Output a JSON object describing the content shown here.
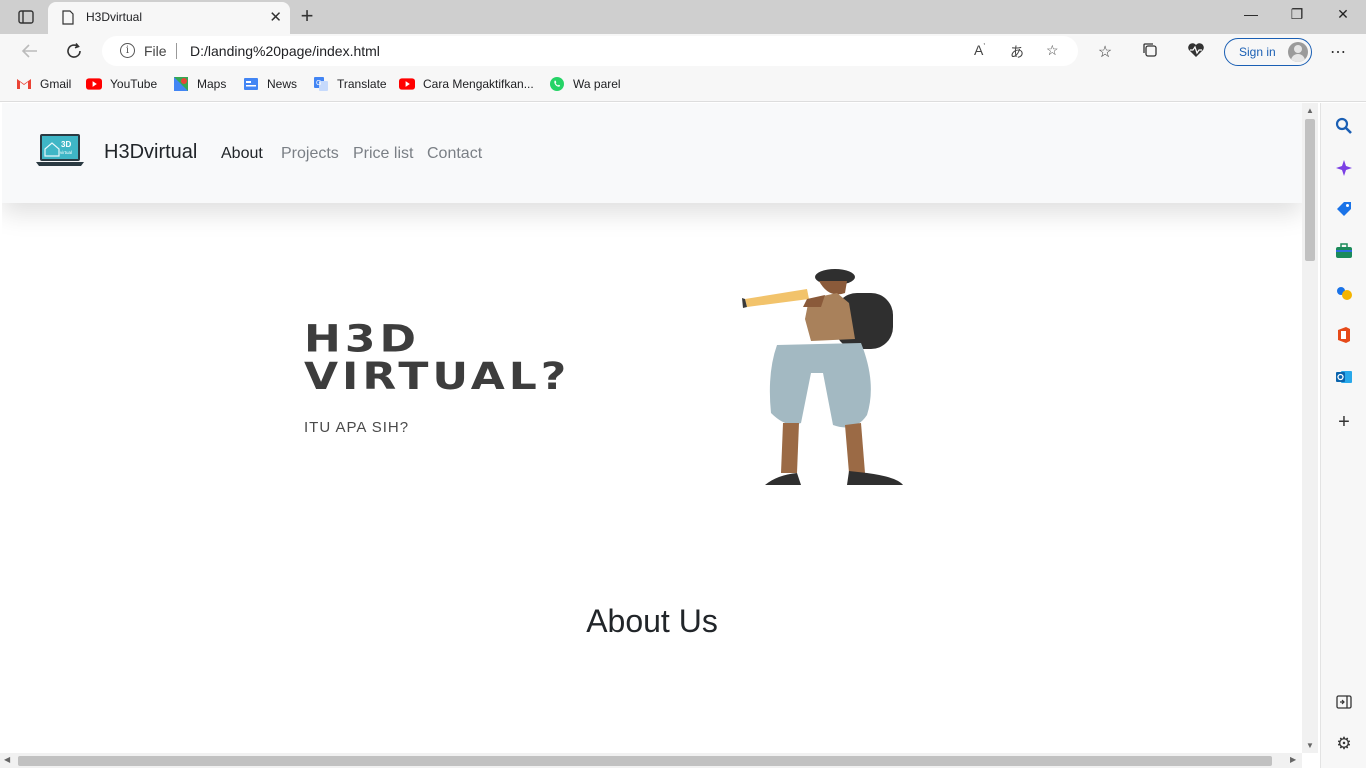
{
  "browser": {
    "tab_title": "H3Dvirtual",
    "new_tab_symbol": "+",
    "close_tab_symbol": "✕",
    "address_label": "File",
    "url": "D:/landing%20page/index.html",
    "signin_label": "Sign in",
    "window": {
      "minimize": "—",
      "maximize": "❐",
      "close": "✕"
    },
    "bookmarks": [
      {
        "label": "Gmail",
        "icon": "gmail-icon"
      },
      {
        "label": "YouTube",
        "icon": "youtube-icon"
      },
      {
        "label": "Maps",
        "icon": "maps-icon"
      },
      {
        "label": "News",
        "icon": "news-icon"
      },
      {
        "label": "Translate",
        "icon": "translate-icon"
      },
      {
        "label": "Cara Mengaktifkan...",
        "icon": "youtube-icon"
      },
      {
        "label": "Wa parel",
        "icon": "whatsapp-icon"
      }
    ]
  },
  "site": {
    "brand": "H3Dvirtual",
    "logo_text": "3D",
    "logo_subtext": "virtual",
    "nav": [
      "About",
      "Projects",
      "Price list",
      "Contact"
    ],
    "active_nav": "About",
    "hero": {
      "title_line1": "H3D",
      "title_line2": "VIRTUAL?",
      "subtitle": "ITU APA SIH?"
    },
    "about_heading": "About Us"
  },
  "colors": {
    "accent": "#1a5fb4",
    "navbar_bg": "#f8f9fa",
    "hero_text": "#3d3d3d"
  }
}
